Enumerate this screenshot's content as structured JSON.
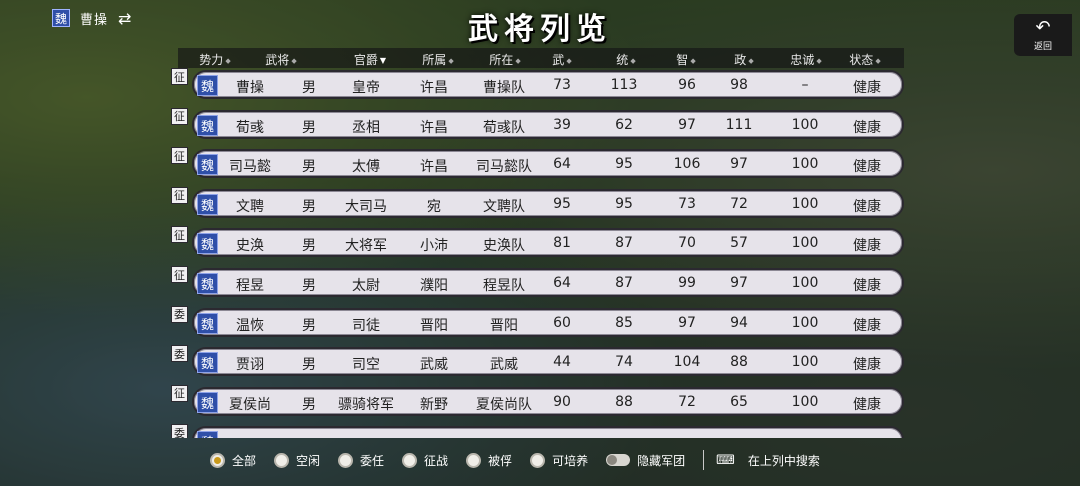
{
  "player": {
    "faction": "魏",
    "name": "曹操"
  },
  "title": "武将列览",
  "back": {
    "label": "返回"
  },
  "columns": [
    "势力",
    "武将",
    "官爵",
    "所属",
    "所在",
    "武",
    "统",
    "智",
    "政",
    "忠诚",
    "状态"
  ],
  "rows": [
    {
      "tag": "征",
      "faction": "魏",
      "name": "曹操",
      "gender": "男",
      "rank": "皇帝",
      "belong": "许昌",
      "location": "曹操队",
      "wu": "73",
      "tong": "113",
      "zhi": "96",
      "zheng": "98",
      "loyalty": "–",
      "state": "健康"
    },
    {
      "tag": "征",
      "faction": "魏",
      "name": "荀彧",
      "gender": "男",
      "rank": "丞相",
      "belong": "许昌",
      "location": "荀彧队",
      "wu": "39",
      "tong": "62",
      "zhi": "97",
      "zheng": "111",
      "loyalty": "100",
      "state": "健康"
    },
    {
      "tag": "征",
      "faction": "魏",
      "name": "司马懿",
      "gender": "男",
      "rank": "太傅",
      "belong": "许昌",
      "location": "司马懿队",
      "wu": "64",
      "tong": "95",
      "zhi": "106",
      "zheng": "97",
      "loyalty": "100",
      "state": "健康"
    },
    {
      "tag": "征",
      "faction": "魏",
      "name": "文聘",
      "gender": "男",
      "rank": "大司马",
      "belong": "宛",
      "location": "文聘队",
      "wu": "95",
      "tong": "95",
      "zhi": "73",
      "zheng": "72",
      "loyalty": "100",
      "state": "健康"
    },
    {
      "tag": "征",
      "faction": "魏",
      "name": "史涣",
      "gender": "男",
      "rank": "大将军",
      "belong": "小沛",
      "location": "史涣队",
      "wu": "81",
      "tong": "87",
      "zhi": "70",
      "zheng": "57",
      "loyalty": "100",
      "state": "健康"
    },
    {
      "tag": "征",
      "faction": "魏",
      "name": "程昱",
      "gender": "男",
      "rank": "太尉",
      "belong": "濮阳",
      "location": "程昱队",
      "wu": "64",
      "tong": "87",
      "zhi": "99",
      "zheng": "97",
      "loyalty": "100",
      "state": "健康"
    },
    {
      "tag": "委",
      "faction": "魏",
      "name": "温恢",
      "gender": "男",
      "rank": "司徒",
      "belong": "晋阳",
      "location": "晋阳",
      "wu": "60",
      "tong": "85",
      "zhi": "97",
      "zheng": "94",
      "loyalty": "100",
      "state": "健康"
    },
    {
      "tag": "委",
      "faction": "魏",
      "name": "贾诩",
      "gender": "男",
      "rank": "司空",
      "belong": "武威",
      "location": "武威",
      "wu": "44",
      "tong": "74",
      "zhi": "104",
      "zheng": "88",
      "loyalty": "100",
      "state": "健康"
    },
    {
      "tag": "征",
      "faction": "魏",
      "name": "夏侯尚",
      "gender": "男",
      "rank": "骠骑将军",
      "belong": "新野",
      "location": "夏侯尚队",
      "wu": "90",
      "tong": "88",
      "zhi": "72",
      "zheng": "65",
      "loyalty": "100",
      "state": "健康"
    },
    {
      "tag": "委",
      "faction": "魏",
      "name": "",
      "gender": "",
      "rank": "",
      "belong": "",
      "location": "",
      "wu": "",
      "tong": "",
      "zhi": "",
      "zheng": "",
      "loyalty": "",
      "state": ""
    }
  ],
  "filters": {
    "options": [
      "全部",
      "空闲",
      "委任",
      "征战",
      "被俘",
      "可培养"
    ],
    "selected": "全部",
    "hide_army": "隐藏军团",
    "search": "在上列中搜索"
  },
  "colors": {
    "faction_blue": "#2f4fa8",
    "radio_selected": "#c99a1c",
    "row_bg": "#e6e3ea"
  }
}
